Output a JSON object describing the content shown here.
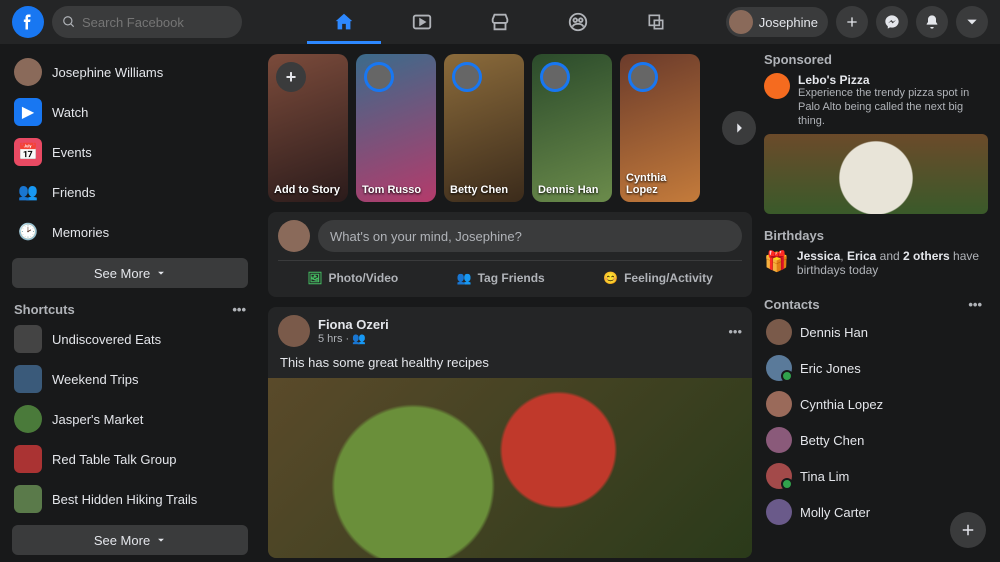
{
  "header": {
    "search_placeholder": "Search Facebook",
    "profile_name": "Josephine"
  },
  "nav_icons": [
    "home",
    "watch",
    "marketplace",
    "groups",
    "gaming"
  ],
  "sidebar": {
    "items": [
      {
        "label": "Josephine Williams",
        "icon": "avatar"
      },
      {
        "label": "Watch",
        "icon": "watch"
      },
      {
        "label": "Events",
        "icon": "events"
      },
      {
        "label": "Friends",
        "icon": "friends"
      },
      {
        "label": "Memories",
        "icon": "memories"
      }
    ],
    "see_more": "See More",
    "shortcuts_title": "Shortcuts",
    "shortcuts": [
      {
        "label": "Undiscovered Eats"
      },
      {
        "label": "Weekend Trips"
      },
      {
        "label": "Jasper's Market"
      },
      {
        "label": "Red Table Talk Group"
      },
      {
        "label": "Best Hidden Hiking Trails"
      }
    ]
  },
  "stories": [
    {
      "label": "Add to Story",
      "add": true
    },
    {
      "label": "Tom Russo"
    },
    {
      "label": "Betty Chen"
    },
    {
      "label": "Dennis Han"
    },
    {
      "label": "Cynthia Lopez"
    }
  ],
  "composer": {
    "placeholder": "What's on your mind, Josephine?",
    "actions": [
      {
        "label": "Photo/Video",
        "color": "#45bd62"
      },
      {
        "label": "Tag Friends",
        "color": "#1877f2"
      },
      {
        "label": "Feeling/Activity",
        "color": "#f7b928"
      }
    ]
  },
  "post": {
    "author": "Fiona Ozeri",
    "meta": "5 hrs · ",
    "text": "This has some great healthy recipes"
  },
  "right": {
    "sponsored_title": "Sponsored",
    "sp_name": "Lebo's Pizza",
    "sp_desc": "Experience the trendy pizza spot in Palo Alto being called the next big thing.",
    "birthdays_title": "Birthdays",
    "bd_line_pre": "Jessica",
    "bd_line_mid": ", ",
    "bd_line_2": "Erica",
    "bd_line_and": " and ",
    "bd_line_3": "2 others",
    "bd_line_suf": " have birthdays today",
    "contacts_title": "Contacts",
    "contacts": [
      {
        "name": "Dennis Han",
        "online": false
      },
      {
        "name": "Eric Jones",
        "online": true
      },
      {
        "name": "Cynthia Lopez",
        "online": false
      },
      {
        "name": "Betty Chen",
        "online": false
      },
      {
        "name": "Tina Lim",
        "online": true
      },
      {
        "name": "Molly Carter",
        "online": false
      }
    ]
  }
}
